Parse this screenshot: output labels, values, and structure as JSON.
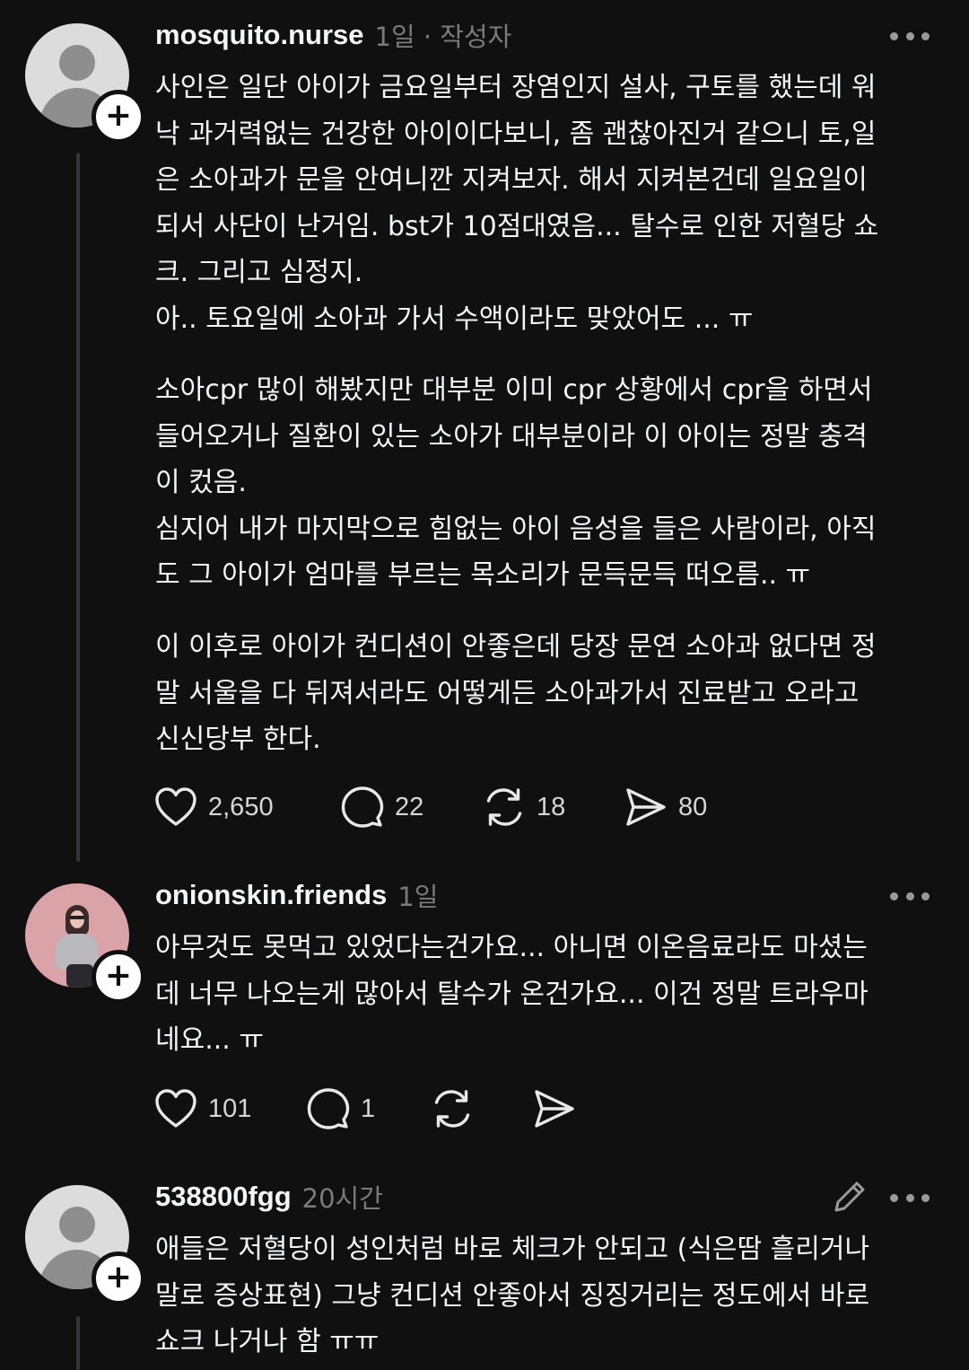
{
  "posts": [
    {
      "username": "mosquito.nurse",
      "meta": "1일 · 작성자",
      "paragraphs": [
        "사인은 일단 아이가 금요일부터 장염인지 설사, 구토를 했는데 워\n낙 과거력없는 건강한 아이이다보니, 좀 괜찮아진거 같으니 토,일\n은 소아과가 문을 안여니깐 지켜보자. 해서 지켜본건데 일요일이\n되서 사단이 난거임. bst가 10점대였음... 탈수로 인한 저혈당 쇼\n크. 그리고 심정지.\n아.. 토요일에 소아과 가서 수액이라도 맞았어도 ... ㅠ",
        "소아cpr 많이 해봤지만 대부분 이미 cpr 상황에서 cpr을 하면서\n들어오거나 질환이 있는 소아가 대부분이라 이 아이는 정말 충격\n이 컸음.\n심지어 내가 마지막으로 힘없는 아이 음성을 들은 사람이라, 아직\n도 그 아이가 엄마를 부르는 목소리가 문득문득 떠오름.. ㅠ",
        "이 이후로 아이가 컨디션이 안좋은데 당장 문연 소아과 없다면 정\n말 서울을 다 뒤져서라도 어떻게든 소아과가서 진료받고 오라고\n신신당부 한다."
      ],
      "likes": "2,650",
      "replies": "22",
      "reposts": "18",
      "shares": "80"
    },
    {
      "username": "onionskin.friends",
      "meta": "1일",
      "paragraphs": [
        "아무것도 못먹고 있었다는건가요... 아니면 이온음료라도 마셨는\n데 너무 나오는게 많아서 탈수가 온건가요... 이건 정말 트라우마\n네요... ㅠ"
      ],
      "likes": "101",
      "replies": "1"
    },
    {
      "username": "538800fgg",
      "meta": "20시간",
      "paragraphs": [
        "애들은 저혈당이 성인처럼 바로 체크가 안되고 (식은땀 흘리거나\n말로 증상표현) 그냥 컨디션 안좋아서 징징거리는 정도에서  바로\n쇼크 나거나 함 ㅠㅠ"
      ]
    }
  ],
  "icons": {
    "like": "heart-icon",
    "reply": "comment-icon",
    "repost": "repost-icon",
    "share": "share-icon",
    "more": "more-icon",
    "edit": "pencil-icon",
    "follow": "plus-icon"
  },
  "colors": {
    "background": "#101010",
    "text": "#f3f5f7",
    "muted": "#7a7a7a",
    "thread_line": "#333638"
  }
}
